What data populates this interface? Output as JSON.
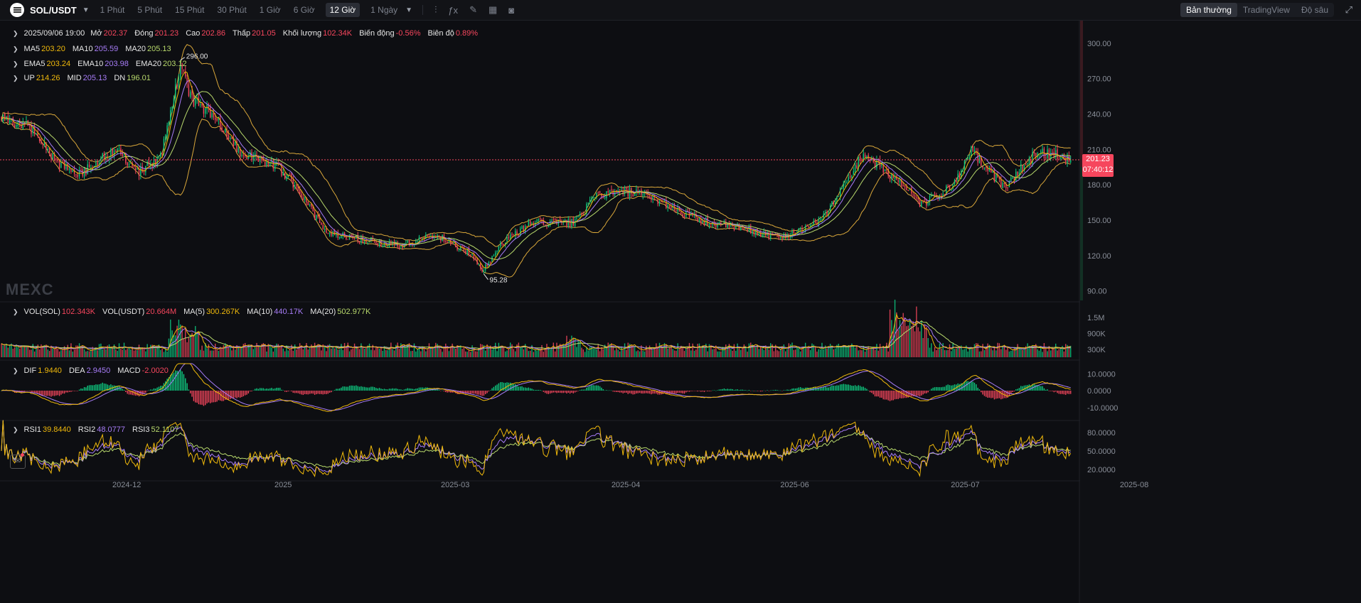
{
  "header": {
    "symbol": "SOL/USDT",
    "intervals": [
      "1 Phút",
      "5 Phút",
      "15 Phút",
      "30 Phút",
      "1 Giờ",
      "6 Giờ",
      "12 Giờ",
      "1 Ngày"
    ],
    "active_interval": "12 Giờ",
    "view_tabs": [
      "Bản thường",
      "TradingView",
      "Độ sâu"
    ],
    "active_view": "Bản thường"
  },
  "ohlc": {
    "date": "2025/09/06 19:00",
    "open_label": "Mở",
    "open": "202.37",
    "close_label": "Đóng",
    "close": "201.23",
    "high_label": "Cao",
    "high": "202.86",
    "low_label": "Thấp",
    "low": "201.05",
    "volume_label": "Khối lượng",
    "volume": "102.34K",
    "change_label": "Biến động",
    "change": "-0.56%",
    "amplitude_label": "Biên độ",
    "amplitude": "0.89%"
  },
  "ma": {
    "ma5_label": "MA5",
    "ma5": "203.20",
    "ma10_label": "MA10",
    "ma10": "205.59",
    "ma20_label": "MA20",
    "ma20": "205.13"
  },
  "ema": {
    "ema5_label": "EMA5",
    "ema5": "203.24",
    "ema10_label": "EMA10",
    "ema10": "203.98",
    "ema20_label": "EMA20",
    "ema20": "203.12"
  },
  "boll": {
    "up_label": "UP",
    "up": "214.26",
    "mid_label": "MID",
    "mid": "205.13",
    "dn_label": "DN",
    "dn": "196.01"
  },
  "vol": {
    "sol_label": "VOL(SOL)",
    "sol": "102.343K",
    "usdt_label": "VOL(USDT)",
    "usdt": "20.664M",
    "ma5_label": "MA(5)",
    "ma5": "300.267K",
    "ma10_label": "MA(10)",
    "ma10": "440.17K",
    "ma20_label": "MA(20)",
    "ma20": "502.977K"
  },
  "macd": {
    "dif_label": "DIF",
    "dif": "1.9440",
    "dea_label": "DEA",
    "dea": "2.9450",
    "macd_label": "MACD",
    "macd": "-2.0020"
  },
  "rsi": {
    "rsi1_label": "RSI1",
    "rsi1": "39.8440",
    "rsi2_label": "RSI2",
    "rsi2": "48.0777",
    "rsi3_label": "RSI3",
    "rsi3": "52.1107"
  },
  "watermark": "MEXC",
  "last_price": {
    "price": "201.23",
    "countdown": "07:40:12"
  },
  "chart_data": {
    "type": "candlestick",
    "price_axis": {
      "ticks": [
        "300.00",
        "270.00",
        "240.00",
        "210.00",
        "180.00",
        "150.00",
        "120.00",
        "90.00"
      ],
      "range": [
        82,
        318
      ]
    },
    "volume_axis": {
      "ticks": [
        "1.5M",
        "900K",
        "300K"
      ],
      "range": [
        0,
        2000000
      ]
    },
    "macd_axis": {
      "ticks": [
        "10.0000",
        "0.0000",
        "-10.0000"
      ],
      "range": [
        -16,
        16
      ]
    },
    "rsi_axis": {
      "ticks": [
        "80.0000",
        "50.0000",
        "20.0000"
      ],
      "range": [
        5,
        95
      ]
    },
    "x_ticks": [
      "2024-12",
      "2025",
      "2025-03",
      "2025-04",
      "2025-06",
      "2025-07",
      "2025-08"
    ],
    "annotations": {
      "high_label": "296.00",
      "low_label": "95.28"
    },
    "close_anchors": [
      [
        0,
        238
      ],
      [
        20,
        226
      ],
      [
        35,
        196
      ],
      [
        48,
        190
      ],
      [
        68,
        210
      ],
      [
        82,
        190
      ],
      [
        96,
        203
      ],
      [
        108,
        280
      ],
      [
        115,
        252
      ],
      [
        128,
        240
      ],
      [
        145,
        206
      ],
      [
        165,
        198
      ],
      [
        180,
        175
      ],
      [
        195,
        140
      ],
      [
        215,
        135
      ],
      [
        240,
        128
      ],
      [
        262,
        138
      ],
      [
        285,
        120
      ],
      [
        290,
        106
      ],
      [
        300,
        128
      ],
      [
        320,
        148
      ],
      [
        345,
        148
      ],
      [
        360,
        172
      ],
      [
        378,
        174
      ],
      [
        395,
        168
      ],
      [
        420,
        150
      ],
      [
        450,
        142
      ],
      [
        470,
        135
      ],
      [
        495,
        150
      ],
      [
        520,
        206
      ],
      [
        540,
        185
      ],
      [
        555,
        163
      ],
      [
        575,
        180
      ],
      [
        585,
        208
      ],
      [
        605,
        178
      ],
      [
        625,
        208
      ],
      [
        637,
        205
      ],
      [
        645,
        201.23
      ]
    ],
    "colors": {
      "up": "#0ecb81",
      "down": "#f6465d",
      "ma5": "#f0b90b",
      "ma10": "#a77cf7",
      "ma20": "#b8d96c",
      "boll": "#d9a73a"
    }
  }
}
